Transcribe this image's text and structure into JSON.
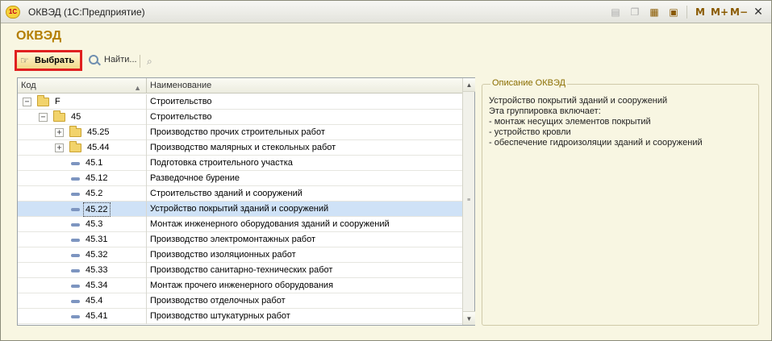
{
  "window": {
    "title": "ОКВЭД  (1С:Предприятие)",
    "app_icon_text": "1С",
    "controls": [
      "M",
      "M+",
      "M−"
    ]
  },
  "form": {
    "title": "ОКВЭД"
  },
  "toolbar": {
    "select_label": "Выбрать",
    "find_label": "Найти..."
  },
  "grid": {
    "columns": {
      "code": "Код",
      "name": "Наименование"
    },
    "rows": [
      {
        "code": "F",
        "name": "Строительство",
        "level": 0,
        "kind": "folder",
        "expander": "−"
      },
      {
        "code": "45",
        "name": "Строительство",
        "level": 1,
        "kind": "folder",
        "expander": "−"
      },
      {
        "code": "45.25",
        "name": "Производство прочих строительных работ",
        "level": 2,
        "kind": "folder",
        "expander": "+"
      },
      {
        "code": "45.44",
        "name": "Производство малярных и стекольных работ",
        "level": 2,
        "kind": "folder",
        "expander": "+"
      },
      {
        "code": "45.1",
        "name": "Подготовка строительного участка",
        "level": 2,
        "kind": "leaf"
      },
      {
        "code": "45.12",
        "name": "Разведочное бурение",
        "level": 2,
        "kind": "leaf"
      },
      {
        "code": "45.2",
        "name": "Строительство зданий и сооружений",
        "level": 2,
        "kind": "leaf"
      },
      {
        "code": "45.22",
        "name": "Устройство покрытий зданий и сооружений",
        "level": 2,
        "kind": "leaf",
        "selected": true
      },
      {
        "code": "45.3",
        "name": "Монтаж инженерного оборудования зданий и сооружений",
        "level": 2,
        "kind": "leaf"
      },
      {
        "code": "45.31",
        "name": "Производство электромонтажных работ",
        "level": 2,
        "kind": "leaf"
      },
      {
        "code": "45.32",
        "name": "Производство изоляционных работ",
        "level": 2,
        "kind": "leaf"
      },
      {
        "code": "45.33",
        "name": "Производство санитарно-технических работ",
        "level": 2,
        "kind": "leaf"
      },
      {
        "code": "45.34",
        "name": "Монтаж прочего инженерного оборудования",
        "level": 2,
        "kind": "leaf"
      },
      {
        "code": "45.4",
        "name": "Производство отделочных работ",
        "level": 2,
        "kind": "leaf"
      },
      {
        "code": "45.41",
        "name": "Производство штукатурных работ",
        "level": 2,
        "kind": "leaf"
      }
    ]
  },
  "description": {
    "caption": "Описание ОКВЭД",
    "lines": [
      "Устройство покрытий зданий и сооружений",
      "Эта группировка включает:",
      "- монтаж несущих элементов покрытий",
      "- устройство кровли",
      "- обеспечение гидроизоляции зданий и сооружений"
    ]
  }
}
